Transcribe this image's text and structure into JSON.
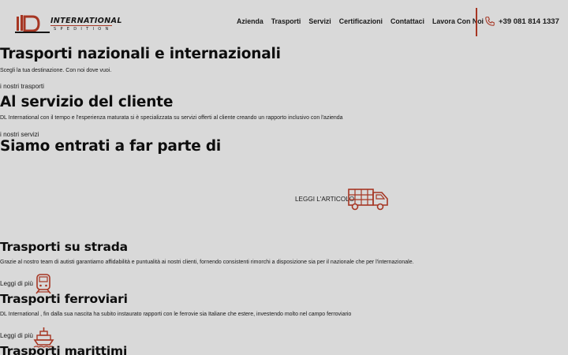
{
  "header": {
    "logo": {
      "name": "INTERNATIONAL",
      "sub": "SPEDITION"
    },
    "nav": [
      {
        "label": "Azienda"
      },
      {
        "label": "Trasporti"
      },
      {
        "label": "Servizi"
      },
      {
        "label": "Certificazioni"
      },
      {
        "label": "Contattaci"
      },
      {
        "label": "Lavora Con Noi"
      }
    ],
    "phone": "+39 081 814 1337"
  },
  "hero": {
    "title": "Trasporti nazionali e internazionali",
    "subtitle": "Scegli la tua destinazione. Con noi dove vuoi.",
    "link": "i nostri trasporti"
  },
  "service": {
    "title": "Al servizio del cliente",
    "text": "DL International con il tempo e l'esperienza maturata si è specializzata su servizi offerti al cliente creando un rapporto inclusivo con l'azienda",
    "link": "i nostri servizi"
  },
  "partner": {
    "title": "Siamo entrati a far parte di",
    "read_article": "LEGGI L'ARTICOLO"
  },
  "road": {
    "title": "Trasporti su strada",
    "text": "Grazie al nostro team di autisti garantiamo affidabilità e puntualità ai nostri clienti, fornendo consistenti rimorchi a disposizione sia per il nazionale che per l'internazionale.",
    "more": "Leggi di più"
  },
  "rail": {
    "title": "Trasporti ferroviari",
    "text": "DL International , fin dalla sua nascita ha subito instaurato rapporti con le ferrovie sia Italiane che estere, investendo molto nel campo ferroviario",
    "more": "Leggi di più"
  },
  "sea": {
    "title": "Trasporti marittimi"
  },
  "colors": {
    "accent": "#c4402a",
    "text": "#111111",
    "overlay": "rgba(0,0,0,0.15)"
  },
  "icons": [
    "logo-mark",
    "phone-icon",
    "truck-icon",
    "train-icon",
    "ship-icon"
  ]
}
